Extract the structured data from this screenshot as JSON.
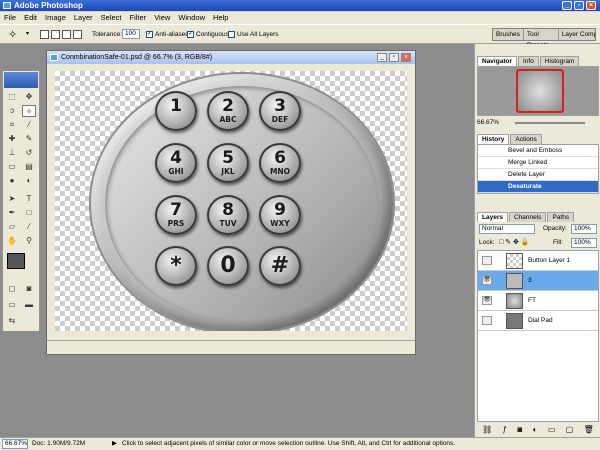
{
  "titlebar": {
    "title": "Adobe Photoshop"
  },
  "menu": [
    "File",
    "Edit",
    "Image",
    "Layer",
    "Select",
    "Filter",
    "View",
    "Window",
    "Help"
  ],
  "options": {
    "tolerance_label": "Tolerance:",
    "tolerance_value": "100",
    "anti_aliased": "Anti-aliased",
    "contiguous": "Contiguous",
    "use_all_layers": "Use All Layers"
  },
  "palette_well": [
    "Brushes",
    "Tool Presets",
    "Layer Comps"
  ],
  "document": {
    "title": "ConmbinationSafe-01.psd @ 66.7% (3, RGB/8#)"
  },
  "keypad": {
    "keys": [
      {
        "num": "1",
        "letters": ""
      },
      {
        "num": "2",
        "letters": "ABC"
      },
      {
        "num": "3",
        "letters": "DEF"
      },
      {
        "num": "4",
        "letters": "GHI"
      },
      {
        "num": "5",
        "letters": "JKL"
      },
      {
        "num": "6",
        "letters": "MNO"
      },
      {
        "num": "7",
        "letters": "PRS"
      },
      {
        "num": "8",
        "letters": "TUV"
      },
      {
        "num": "9",
        "letters": "WXY"
      },
      {
        "num": "*",
        "letters": ""
      },
      {
        "num": "0",
        "letters": ""
      },
      {
        "num": "#",
        "letters": ""
      }
    ]
  },
  "navigator": {
    "tabs": [
      "Navigator",
      "Info",
      "Histogram"
    ],
    "zoom": "66.67%"
  },
  "history": {
    "tabs": [
      "History",
      "Actions"
    ],
    "items": [
      "Bevel and Emboss",
      "Merge Linked",
      "Delete Layer",
      "Desaturate"
    ],
    "selected": "Desaturate"
  },
  "layers": {
    "tabs": [
      "Layers",
      "Channels",
      "Paths"
    ],
    "blend_mode": "Normal",
    "opacity_label": "Opacity:",
    "opacity": "100%",
    "lock_label": "Lock:",
    "fill_label": "Fill:",
    "fill": "100%",
    "items": [
      {
        "name": "Button Layer 1"
      },
      {
        "name": "3"
      },
      {
        "name": "FT"
      },
      {
        "name": "Dial Pad"
      }
    ],
    "selected": "3"
  },
  "status": {
    "zoom": "66.67%",
    "doc": "Doc: 1.90M/9.72M",
    "hint": "Click to select adjacent pixels of similar color or move selection outline.  Use Shift, Alt, and Ctrl for additional options."
  },
  "colors": {
    "title_bg": "#1c48b8",
    "selection": "#316ac5",
    "layer_selection": "#6aa9ea"
  }
}
